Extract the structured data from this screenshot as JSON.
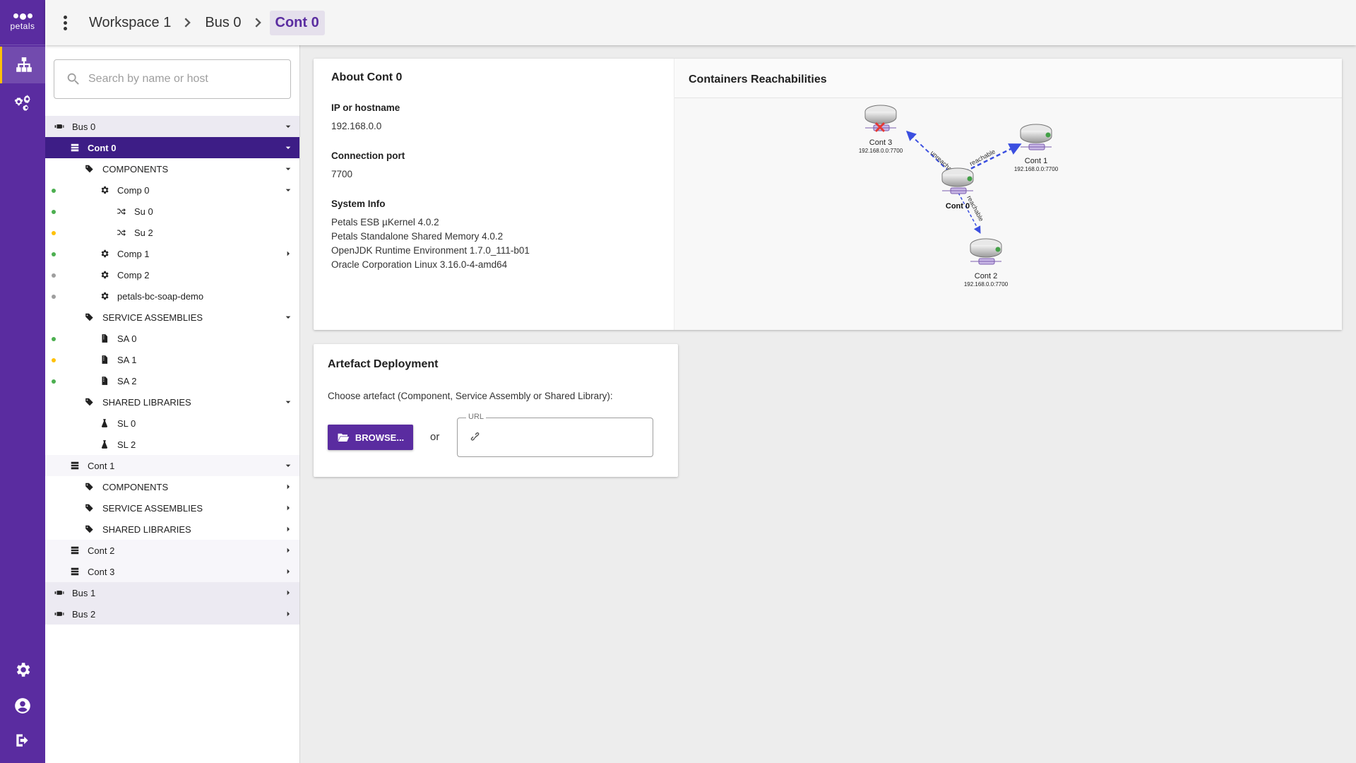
{
  "brand": {
    "logo_text": "petals",
    "accent": "#5a2ca0",
    "selected_row": "#3d1d86"
  },
  "breadcrumb": [
    {
      "label": "Workspace 1"
    },
    {
      "label": "Bus 0"
    },
    {
      "label": "Cont 0"
    }
  ],
  "search": {
    "placeholder": "Search by name or host",
    "value": ""
  },
  "tree": {
    "bus0": "Bus 0",
    "cont0": "Cont 0",
    "cont0_components": "COMPONENTS",
    "comp0": "Comp 0",
    "su0": "Su 0",
    "su2": "Su 2",
    "comp1": "Comp 1",
    "comp2": "Comp 2",
    "soap_demo": "petals-bc-soap-demo",
    "cont0_sa": "SERVICE ASSEMBLIES",
    "sa0": "SA 0",
    "sa1": "SA 1",
    "sa2": "SA 2",
    "cont0_sl": "SHARED LIBRARIES",
    "sl0": "SL 0",
    "sl2": "SL 2",
    "cont1": "Cont 1",
    "cont1_components": "COMPONENTS",
    "cont1_sa": "SERVICE ASSEMBLIES",
    "cont1_sl": "SHARED LIBRARIES",
    "cont2": "Cont 2",
    "cont3": "Cont 3",
    "bus1": "Bus 1",
    "bus2": "Bus 2"
  },
  "status_colors": {
    "started": "#4caf50",
    "stopped": "#ffc107",
    "unknown": "#9e9e9e"
  },
  "about": {
    "title": "About Cont 0",
    "host_label": "IP or hostname",
    "host_value": "192.168.0.0",
    "port_label": "Connection port",
    "port_value": "7700",
    "sysinfo_label": "System Info",
    "sysinfo": [
      "Petals ESB µKernel 4.0.2",
      "Petals Standalone Shared Memory 4.0.2",
      "OpenJDK Runtime Environment 1.7.0_111-b01",
      "Oracle Corporation Linux 3.16.0-4-amd64"
    ]
  },
  "reachability": {
    "title": "Containers Reachabilities",
    "nodes": {
      "cont3": {
        "name": "Cont 3",
        "addr": "192.168.0.0:7700"
      },
      "cont1": {
        "name": "Cont 1",
        "addr": "192.168.0.0:7700"
      },
      "cont0": {
        "name": "Cont 0"
      },
      "cont2": {
        "name": "Cont 2",
        "addr": "192.168.0.0:7700"
      }
    },
    "links": {
      "to_cont3": "unreachable",
      "to_cont1": "reachable",
      "to_cont2": "reachable"
    }
  },
  "deploy": {
    "title": "Artefact Deployment",
    "description": "Choose artefact (Component, Service Assembly or Shared Library):",
    "browse_label": "BROWSE...",
    "or_label": "or",
    "url_label": "URL",
    "url_value": ""
  }
}
